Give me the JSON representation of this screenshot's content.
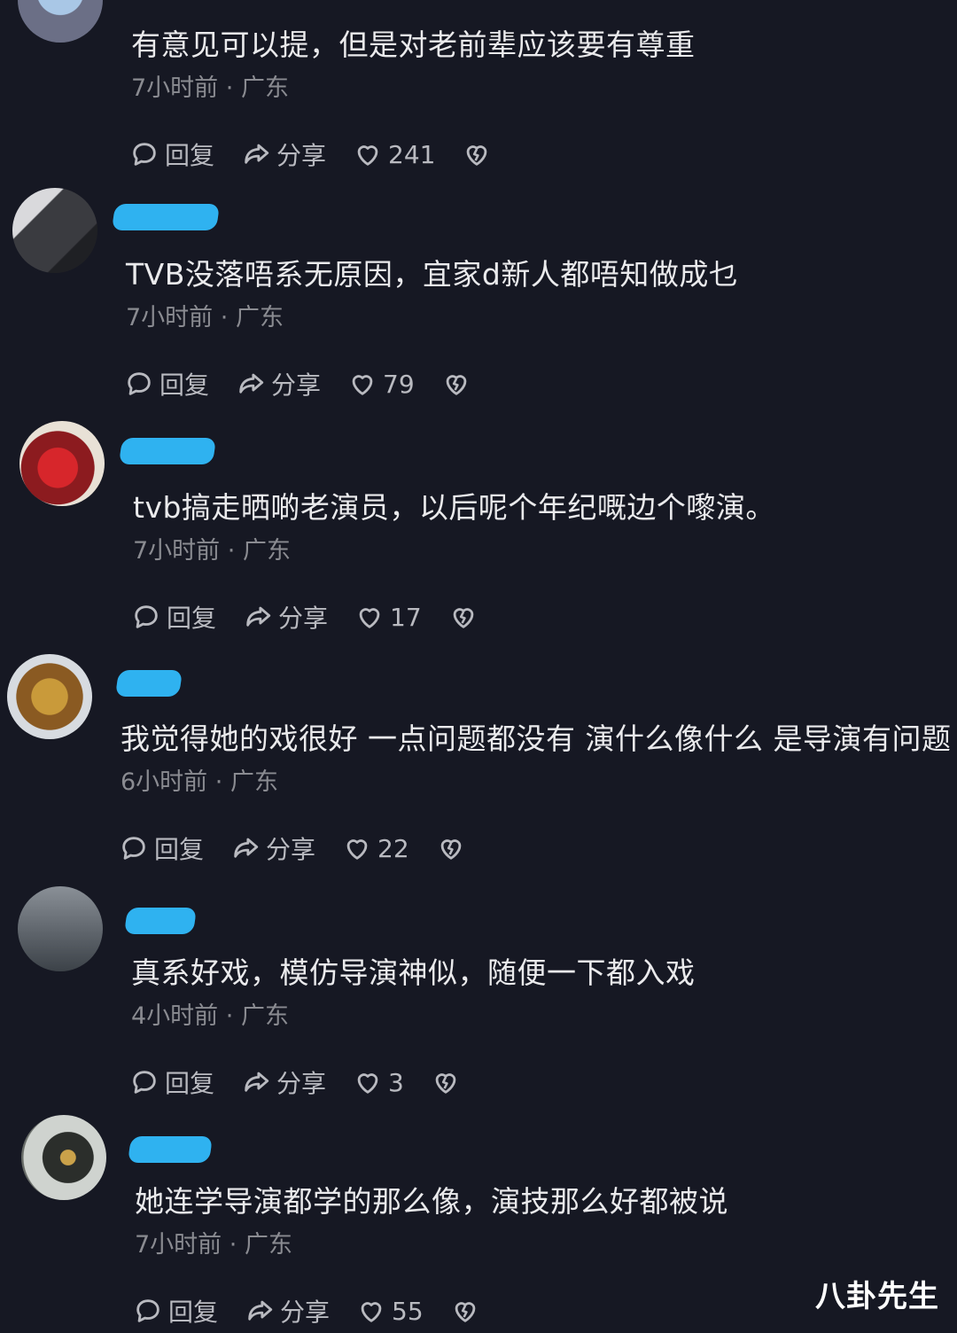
{
  "comments": [
    {
      "text": "有意见可以提，但是对老前辈应该要有尊重",
      "time": "7小时前",
      "location": "广东",
      "reply_label": "回复",
      "share_label": "分享",
      "likes": "241"
    },
    {
      "text": "TVB没落唔系无原因，宜家d新人都唔知做成乜",
      "time": "7小时前",
      "location": "广东",
      "reply_label": "回复",
      "share_label": "分享",
      "likes": "79"
    },
    {
      "text": "tvb搞走晒啲老演员，以后呢个年纪嘅边个嚟演。",
      "time": "7小时前",
      "location": "广东",
      "reply_label": "回复",
      "share_label": "分享",
      "likes": "17"
    },
    {
      "text": "我觉得她的戏很好 一点问题都没有 演什么像什么 是导演有问题",
      "time": "6小时前",
      "location": "广东",
      "reply_label": "回复",
      "share_label": "分享",
      "likes": "22"
    },
    {
      "text": "真系好戏，模仿导演神似，随便一下都入戏",
      "time": "4小时前",
      "location": "广东",
      "reply_label": "回复",
      "share_label": "分享",
      "likes": "3"
    },
    {
      "text": "她连学导演都学的那么像，演技那么好都被说",
      "time": "7小时前",
      "location": "广东",
      "reply_label": "回复",
      "share_label": "分享",
      "likes": "55"
    }
  ],
  "meta_separator": "·",
  "watermark": "八卦先生",
  "icons": {
    "reply": "speech-bubble-icon",
    "share": "share-arrow-icon",
    "like": "heart-icon",
    "dislike": "broken-heart-icon"
  },
  "colors": {
    "background": "#161823",
    "text": "#eaeaec",
    "meta": "#8a8b91",
    "username_redaction": "#2fb2f0"
  }
}
